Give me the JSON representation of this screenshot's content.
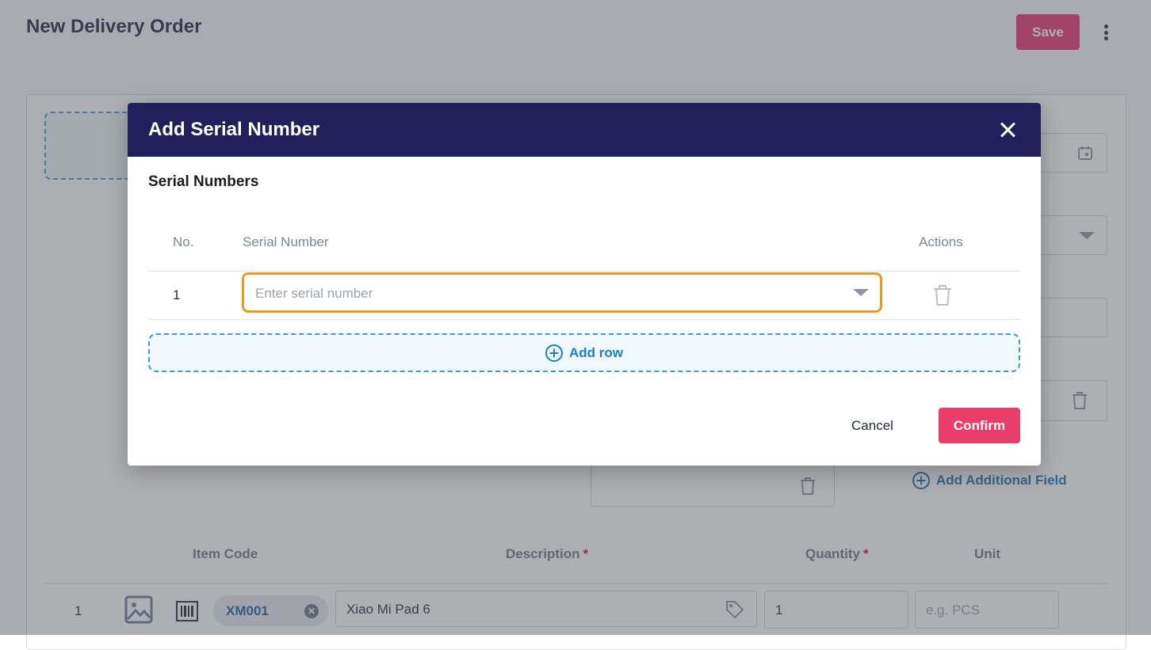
{
  "page": {
    "title": "New Delivery Order",
    "save_label": "Save",
    "more_icon": "more-vertical-icon",
    "add_field_label": "Add Additional Field",
    "items_table": {
      "headers": {
        "item_code": "Item Code",
        "description": "Description",
        "quantity": "Quantity",
        "unit": "Unit"
      },
      "required_mark": "*",
      "rows": [
        {
          "no": "1",
          "item_code": "XM001",
          "description": "Xiao Mi Pad 6",
          "quantity": "1",
          "unit_placeholder": "e.g. PCS"
        }
      ]
    }
  },
  "modal": {
    "title": "Add Serial Number",
    "close_icon": "close-icon",
    "section_title": "Serial Numbers",
    "table": {
      "headers": {
        "no": "No.",
        "serial_number": "Serial Number",
        "actions": "Actions"
      },
      "rows": [
        {
          "no": "1",
          "serial_value": "",
          "serial_placeholder": "Enter serial number"
        }
      ]
    },
    "add_row_label": "Add row",
    "cancel_label": "Cancel",
    "confirm_label": "Confirm"
  },
  "colors": {
    "modal_header": "#21205a",
    "primary_button": "#ea3d6c",
    "focus_border": "#ec9a1e",
    "link_blue": "#1a7fc4"
  }
}
